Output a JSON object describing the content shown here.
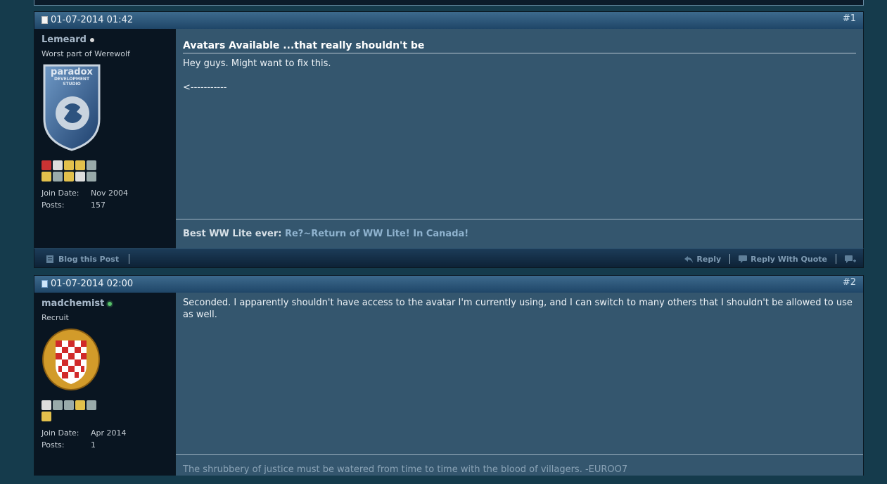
{
  "posts": [
    {
      "date": "01-07-2014 01:42",
      "number": "#1",
      "username": "Lemeard",
      "user_title": "Worst part of Werewolf",
      "join_date_label": "Join Date:",
      "join_date": "Nov 2004",
      "posts_label": "Posts:",
      "post_count": "157",
      "title": "Avatars Available ...that really shouldn't be",
      "message_lines": [
        "Hey guys. Might want to fix this.",
        "<-----------"
      ],
      "signature_text": "Best WW Lite ever: ",
      "signature_link": "Re?~Return of WW Lite! In Canada!",
      "avatar_text": [
        "paradox",
        "DEVELOPMENT",
        "STUDIO"
      ],
      "footer": {
        "blog_label": "Blog this Post",
        "reply_label": "Reply",
        "reply_quote_label": "Reply With Quote"
      }
    },
    {
      "date": "01-07-2014 02:00",
      "number": "#2",
      "username": "madchemist",
      "user_title": "Recruit",
      "join_date_label": "Join Date:",
      "join_date": "Apr 2014",
      "posts_label": "Posts:",
      "post_count": "1",
      "message": "Seconded. I apparently shouldn't have access to the avatar I'm currently using, and I can switch to many others that I shouldn't be allowed to use as well.",
      "signature": "The shrubbery of justice must be watered from time to time with the blood of villagers. -EUROO7"
    }
  ]
}
